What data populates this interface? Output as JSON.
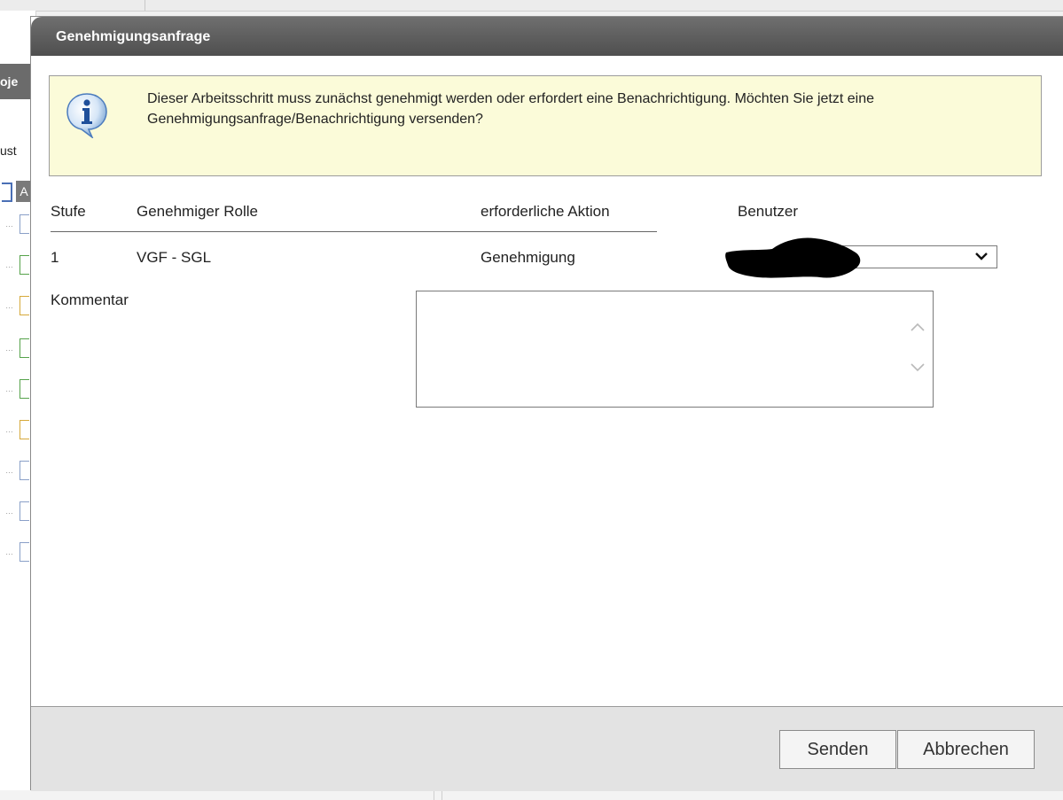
{
  "background": {
    "tab_label": "oje",
    "label_fragment": "ust",
    "button_fragment": "A",
    "rows": [
      {
        "dots": "…",
        "color": "blue"
      },
      {
        "dots": "…",
        "color": "green"
      },
      {
        "dots": "…",
        "color": "yellow"
      },
      {
        "dots": "…",
        "color": "green"
      },
      {
        "dots": "…",
        "color": "green"
      },
      {
        "dots": "…",
        "color": "yellow"
      },
      {
        "dots": "…",
        "color": "blue"
      },
      {
        "dots": "…",
        "color": "blue"
      },
      {
        "dots": "…",
        "color": "blue"
      }
    ]
  },
  "dialog": {
    "title": "Genehmigungsanfrage",
    "info": {
      "icon": "info-icon",
      "message": "Dieser Arbeitsschritt muss zunächst genehmigt werden oder erfordert eine Benachrichtigung. Möchten Sie jetzt eine Genehmigungsanfrage/Benachrichtigung versenden?"
    },
    "table": {
      "headers": [
        "Stufe",
        "Genehmiger Rolle",
        "erforderliche Aktion",
        "Benutzer"
      ],
      "rows": [
        {
          "stufe": "1",
          "rolle": "VGF - SGL",
          "aktion": "Genehmigung",
          "benutzer": ""
        }
      ]
    },
    "comment": {
      "label": "Kommentar",
      "value": ""
    },
    "buttons": {
      "send": "Senden",
      "cancel": "Abbrechen"
    }
  },
  "colors": {
    "titlebar": "#5a5a5a",
    "info_background": "#fbfbd9",
    "footer": "#e3e3e3"
  }
}
